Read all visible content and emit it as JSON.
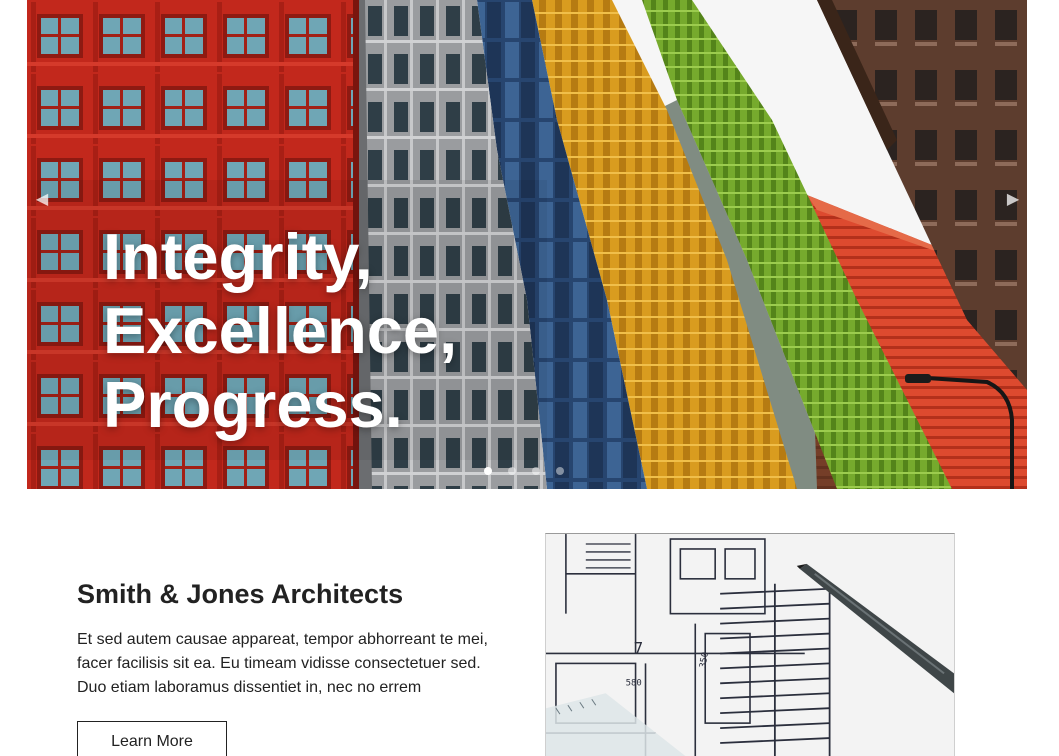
{
  "hero": {
    "caption_lines": [
      "Integrity,",
      "Excellence,",
      "Progress."
    ],
    "prev_icon": "chevron-left-icon",
    "next_icon": "chevron-right-icon",
    "prev_glyph": "◀",
    "next_glyph": "▶",
    "slide_count": 4,
    "active_slide": 1,
    "colors": {
      "red_building": "#c2281c",
      "grey_building": "#8d8f92",
      "glass_building": "#2d4a7a",
      "yellow_building": "#d69a1c",
      "green_building": "#6ea12a",
      "orange_building": "#d9442a",
      "brown_building": "#5a3a2c",
      "sky": "#f6f6f6"
    }
  },
  "intro": {
    "title": "Smith & Jones Architects",
    "paragraph_lines": [
      "Et sed autem causae appareat, tempor abhorreant te mei,",
      "facer facilisis sit ea. Eu timeam vidisse consectetuer sed.",
      "Duo etiam laboramus dissentiet in, nec no errem"
    ],
    "button_label": "Learn More"
  },
  "blueprint": {
    "labels": [
      "7",
      "580",
      "350"
    ]
  }
}
